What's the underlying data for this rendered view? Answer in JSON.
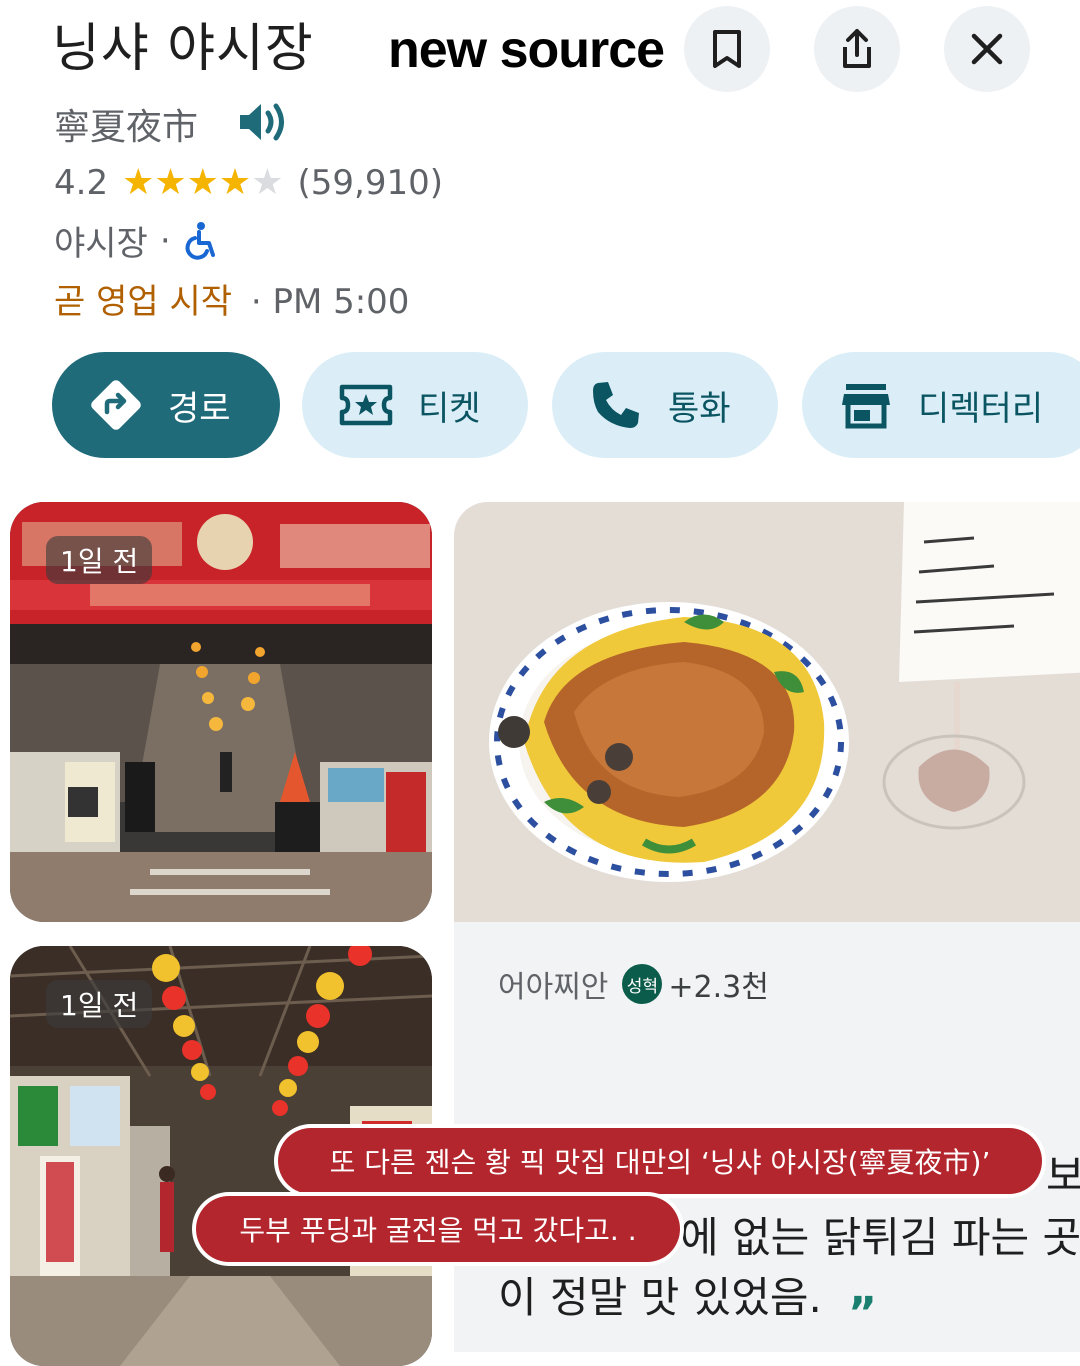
{
  "place": {
    "title": "닝샤 야시장",
    "subtitle": "寧夏夜市",
    "rating": "4.2",
    "rating_value": 4.2,
    "review_count": "(59,910)",
    "category": "야시장",
    "separator": "·",
    "status": "곧 영업 시작",
    "opening_time": "· PM 5:00"
  },
  "watermark": "new source",
  "top_actions": {
    "save_icon": "bookmark-icon",
    "share_icon": "share-icon",
    "close_icon": "close-icon"
  },
  "actions": [
    {
      "label": "경로",
      "icon": "directions-icon"
    },
    {
      "label": "티켓",
      "icon": "ticket-icon"
    },
    {
      "label": "통화",
      "icon": "phone-icon"
    },
    {
      "label": "디렉터리",
      "icon": "storefront-icon"
    }
  ],
  "photos": [
    {
      "badge": "1일 전",
      "desc_icon": "night-market-entrance-photo"
    },
    {
      "badge": "1일 전",
      "desc_icon": "night-market-lanterns-photo"
    },
    {
      "desc_icon": "oyster-omelette-photo"
    }
  ],
  "review": {
    "author": "어아찌안",
    "avatar_text": "성혁",
    "plus": "+2.3천",
    "line1": "보",
    "line2": "에 없는 닭튀김 파는 곳",
    "line3": "이 정말 맛 있었음.",
    "quote": "”"
  },
  "captions": [
    "또 다른 젠슨 황 픽 맛집 대만의 ‘닝샤 야시장(寧夏夜市)’",
    "두부 푸딩과 굴전을 먹고 갔다고. ."
  ],
  "colors": {
    "accent": "#1f6b7a",
    "chip": "#dbeef7",
    "star": "#f4b400",
    "status": "#b06000",
    "caption": "#b3262d"
  }
}
